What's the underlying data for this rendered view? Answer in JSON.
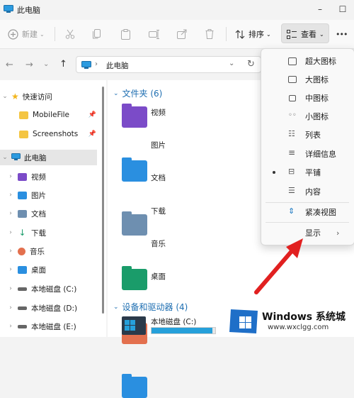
{
  "window": {
    "title": "此电脑",
    "minimize": "–",
    "maximize": "☐"
  },
  "toolbar": {
    "new_label": "新建",
    "sort_label": "排序",
    "view_label": "查看",
    "more_label": "•••"
  },
  "address": {
    "location": "此电脑"
  },
  "nav": {
    "quick_access": "快速访问",
    "pinned": [
      "MobileFile",
      "Screenshots"
    ],
    "this_pc": "此电脑",
    "items": [
      "视频",
      "图片",
      "文档",
      "下载",
      "音乐",
      "桌面",
      "本地磁盘 (C:)",
      "本地磁盘 (D:)",
      "本地磁盘 (E:)"
    ]
  },
  "content": {
    "folders_header": "文件夹 (6)",
    "folders": [
      "视频",
      "图片",
      "文档",
      "下载",
      "音乐",
      "桌面"
    ],
    "drives_header": "设备和驱动器 (4)",
    "drive_c": "本地磁盘 (C:)",
    "drive_c_usage": 0.95
  },
  "view_menu": {
    "items": [
      "超大图标",
      "大图标",
      "中图标",
      "小图标",
      "列表",
      "详细信息",
      "平铺",
      "内容"
    ],
    "selected": "平铺",
    "compact": "紧凑视图",
    "show": "显示"
  },
  "watermark": {
    "brand": "Windows 系统城",
    "url": "www.wxclgg.com"
  },
  "colors": {
    "accent": "#1a78c2",
    "video": "#7b4bc8",
    "pictures": "#2a8fe0",
    "docs": "#6e8fb0",
    "downloads": "#1a9c6a",
    "music": "#e3704e",
    "desktop": "#2a8fe0",
    "drive_bar": "#26a0da"
  }
}
